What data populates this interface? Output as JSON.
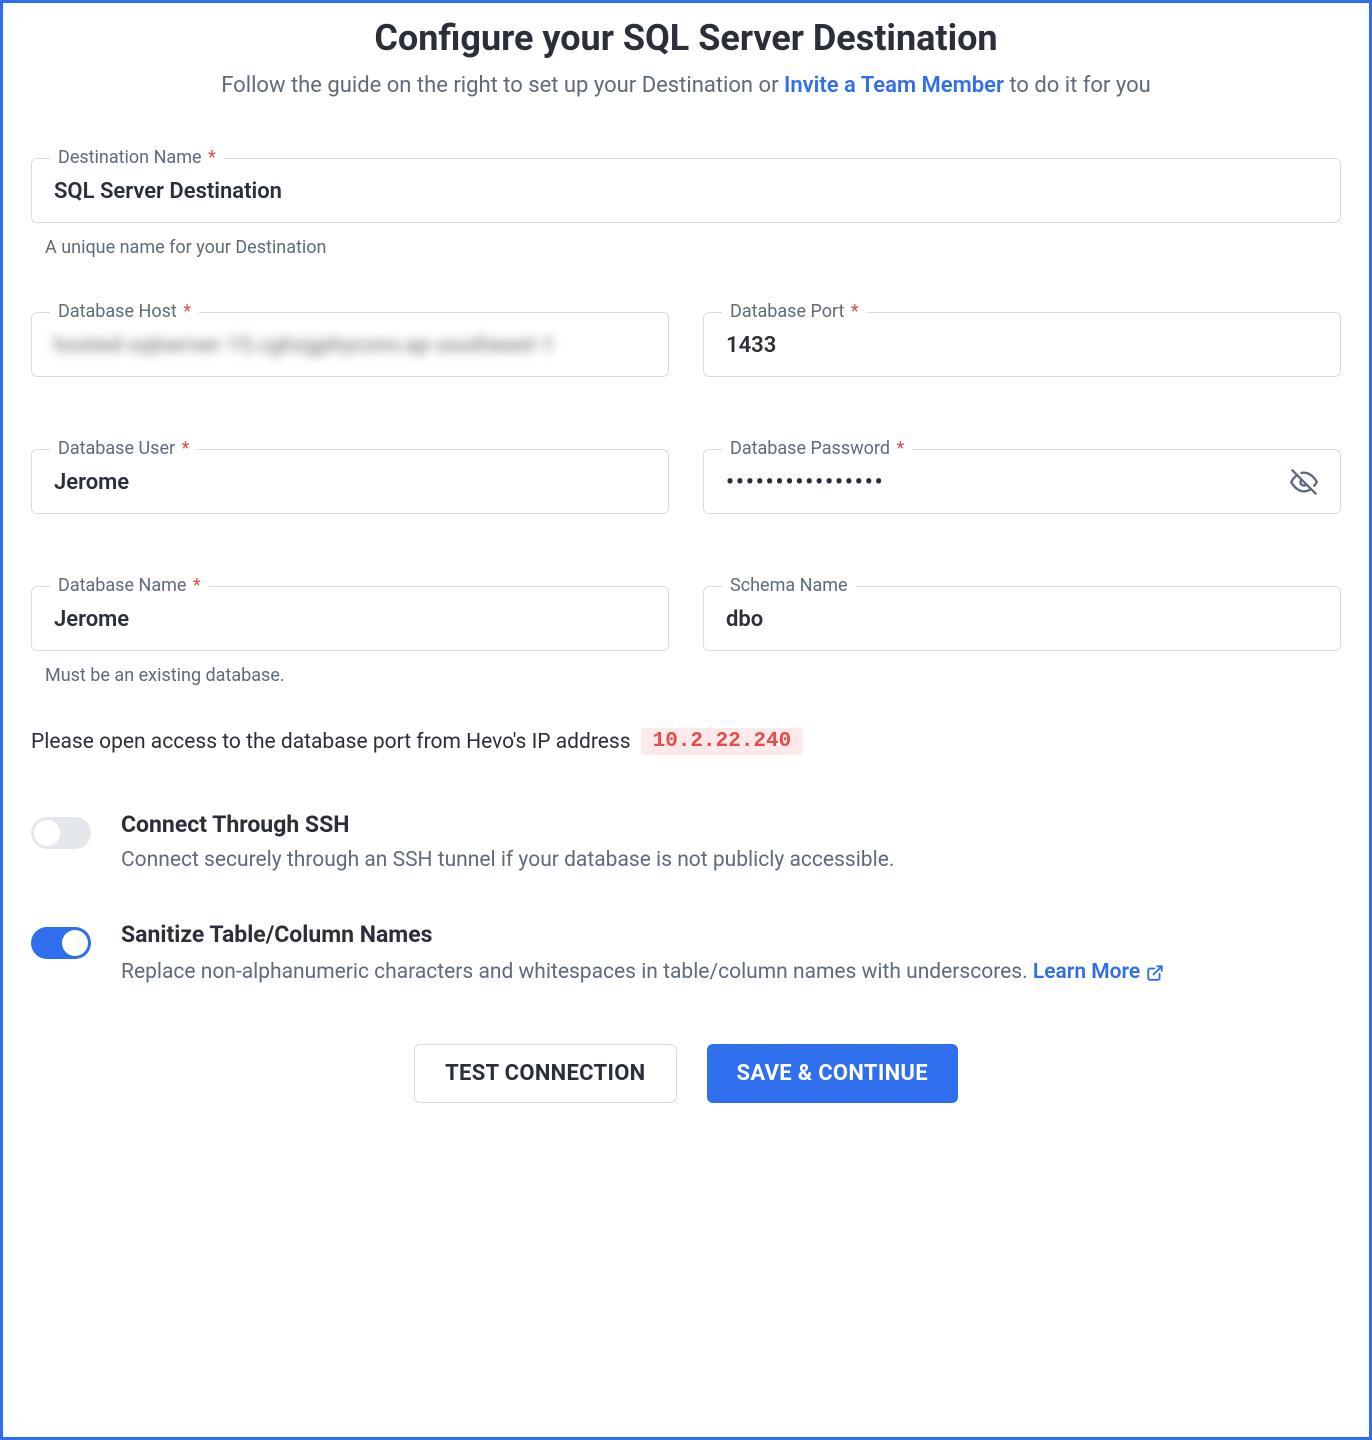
{
  "header": {
    "title": "Configure your SQL Server Destination",
    "subtitle_pre": "Follow the guide on the right to set up your Destination or ",
    "subtitle_link": "Invite a Team Member",
    "subtitle_post": " to do it for you"
  },
  "fields": {
    "dest_name": {
      "label": "Destination Name",
      "value": "SQL Server Destination",
      "helper": "A unique name for your Destination"
    },
    "db_host": {
      "label": "Database Host",
      "value": "hosted-sqlserver-15.cghzgphyconv.ap-southeast-1"
    },
    "db_port": {
      "label": "Database Port",
      "value": "1433"
    },
    "db_user": {
      "label": "Database User",
      "value": "Jerome"
    },
    "db_pass": {
      "label": "Database Password",
      "value": "••••••••••••••••"
    },
    "db_name": {
      "label": "Database Name",
      "value": "Jerome",
      "helper": "Must be an existing database."
    },
    "schema": {
      "label": "Schema Name",
      "value": "dbo"
    }
  },
  "ip_note": {
    "text": "Please open access to the database port from Hevo's IP address",
    "ip": "10.2.22.240"
  },
  "toggles": {
    "ssh": {
      "title": "Connect Through SSH",
      "desc": "Connect securely through an SSH tunnel if your database is not publicly accessible.",
      "on": false
    },
    "sanitize": {
      "title": "Sanitize Table/Column Names",
      "desc": "Replace non-alphanumeric characters and whitespaces in table/column names with underscores. ",
      "learn": "Learn More",
      "on": true
    }
  },
  "actions": {
    "test": "TEST CONNECTION",
    "save": "SAVE & CONTINUE"
  }
}
